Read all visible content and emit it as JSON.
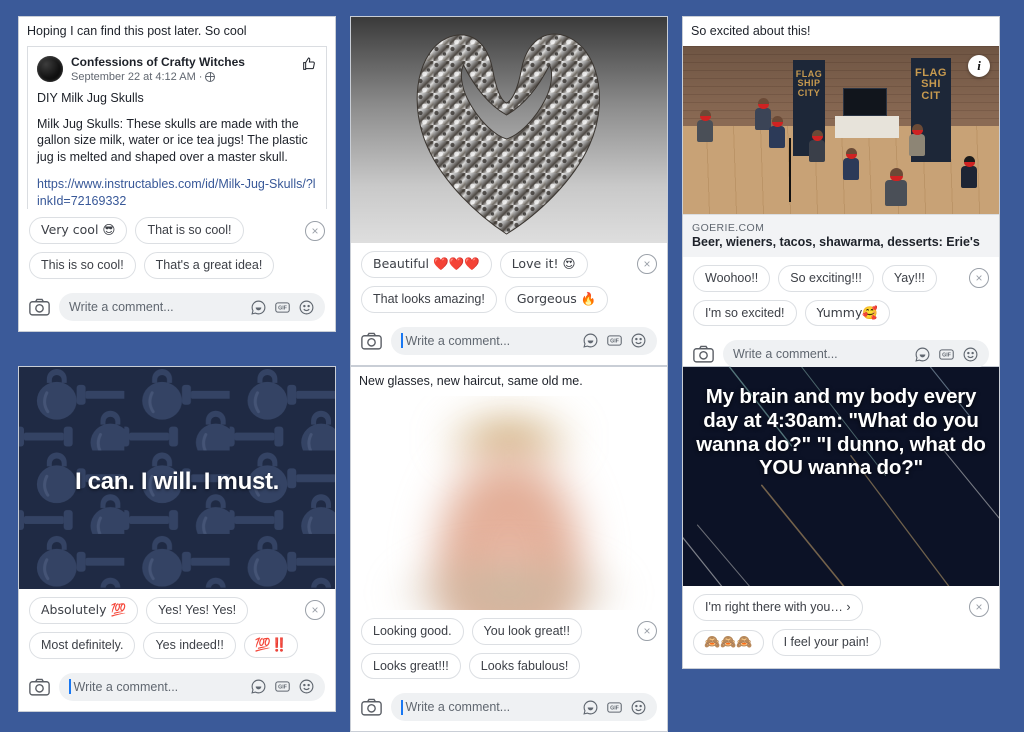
{
  "background_color": "#3b5a99",
  "cards": [
    {
      "id": "card-milk-jug-skulls",
      "caption": "Hoping I can find this post later. So cool",
      "embedded_post": {
        "page_name": "Confessions of Crafty Witches",
        "timestamp": "September 22 at 4:12 AM",
        "privacy_icon": "globe-icon",
        "title": "DIY Milk Jug Skulls",
        "body": "Milk Jug Skulls: These skulls are made with the gallon size milk, water or ice tea jugs! The plastic jug is melted and shaped over a master skull.",
        "link": "https://www.instructables.com/id/Milk-Jug-Skulls/?linkId=72169332",
        "like_icon": "thumbs-up-icon"
      },
      "suggestions_row1": [
        "Very cool 😎",
        "That is so cool!"
      ],
      "suggestions_row2": [
        "This is so cool!",
        "That's a great idea!"
      ],
      "composer": {
        "placeholder": "Write a comment...",
        "caret": false
      },
      "dismiss_label": "×"
    },
    {
      "id": "card-stone-heart",
      "caption": null,
      "media": {
        "type": "image",
        "description": "marble heart sculpture on gray gradient"
      },
      "suggestions_row1": [
        "Beautiful ❤️❤️❤️",
        "Love it! 😍"
      ],
      "suggestions_row2": [
        "That looks amazing!",
        "Gorgeous 🔥"
      ],
      "composer": {
        "placeholder": "Write a comment...",
        "caret": true
      },
      "dismiss_label": "×"
    },
    {
      "id": "card-goerie-link",
      "caption": "So excited about this!",
      "media": {
        "type": "image",
        "description": "people in red masks at Flagship City food hall event"
      },
      "info_badge": "i",
      "link_preview": {
        "domain": "GOERIE.COM",
        "title": "Beer, wieners, tacos, shawarma, desserts: Erie's"
      },
      "suggestions_row1": [
        "Woohoo!!",
        "So exciting!!!",
        "Yay!!!"
      ],
      "suggestions_row2": [
        "I'm so excited!",
        "Yummy🥰"
      ],
      "composer": {
        "placeholder": "Write a comment...",
        "caret": false
      },
      "dismiss_label": "×"
    },
    {
      "id": "card-gym-motivation",
      "caption": null,
      "media": {
        "type": "image",
        "description": "kettlebell and dumbbell pattern on navy background"
      },
      "overlay_text": "I can. I will. I must.",
      "suggestions_row1": [
        "Absolutely 💯",
        "Yes! Yes! Yes!"
      ],
      "suggestions_row2": [
        "Most definitely.",
        "Yes indeed!!",
        "💯‼️"
      ],
      "composer": {
        "placeholder": "Write a comment...",
        "caret": true
      },
      "dismiss_label": "×"
    },
    {
      "id": "card-new-glasses",
      "caption": "New glasses, new haircut, same old me.",
      "media": {
        "type": "image",
        "description": "heavily blurred portrait photo of a person"
      },
      "suggestions_row1": [
        "Looking good.",
        "You look great!!"
      ],
      "suggestions_row2": [
        "Looks great!!!",
        "Looks fabulous!"
      ],
      "composer": {
        "placeholder": "Write a comment...",
        "caret": true
      },
      "dismiss_label": "×"
    },
    {
      "id": "card-430am-meme",
      "caption": null,
      "media": {
        "type": "image",
        "description": "dark navy meme image with diagonal light streaks"
      },
      "overlay_text": "My brain and my body every day at 4:30am: \"What do you wanna do?\" \"I dunno, what do YOU wanna do?\"",
      "suggestions_row1": [
        "I'm right there with you… ›"
      ],
      "suggestions_row2": [
        "🙈🙈🙈",
        "I feel your pain!"
      ],
      "composer": null,
      "dismiss_label": "×"
    }
  ],
  "icons": {
    "camera": "camera-icon",
    "sticker": "sticker-icon",
    "gif": "gif-icon",
    "emoji": "emoji-icon",
    "gif_label": "GIF"
  }
}
